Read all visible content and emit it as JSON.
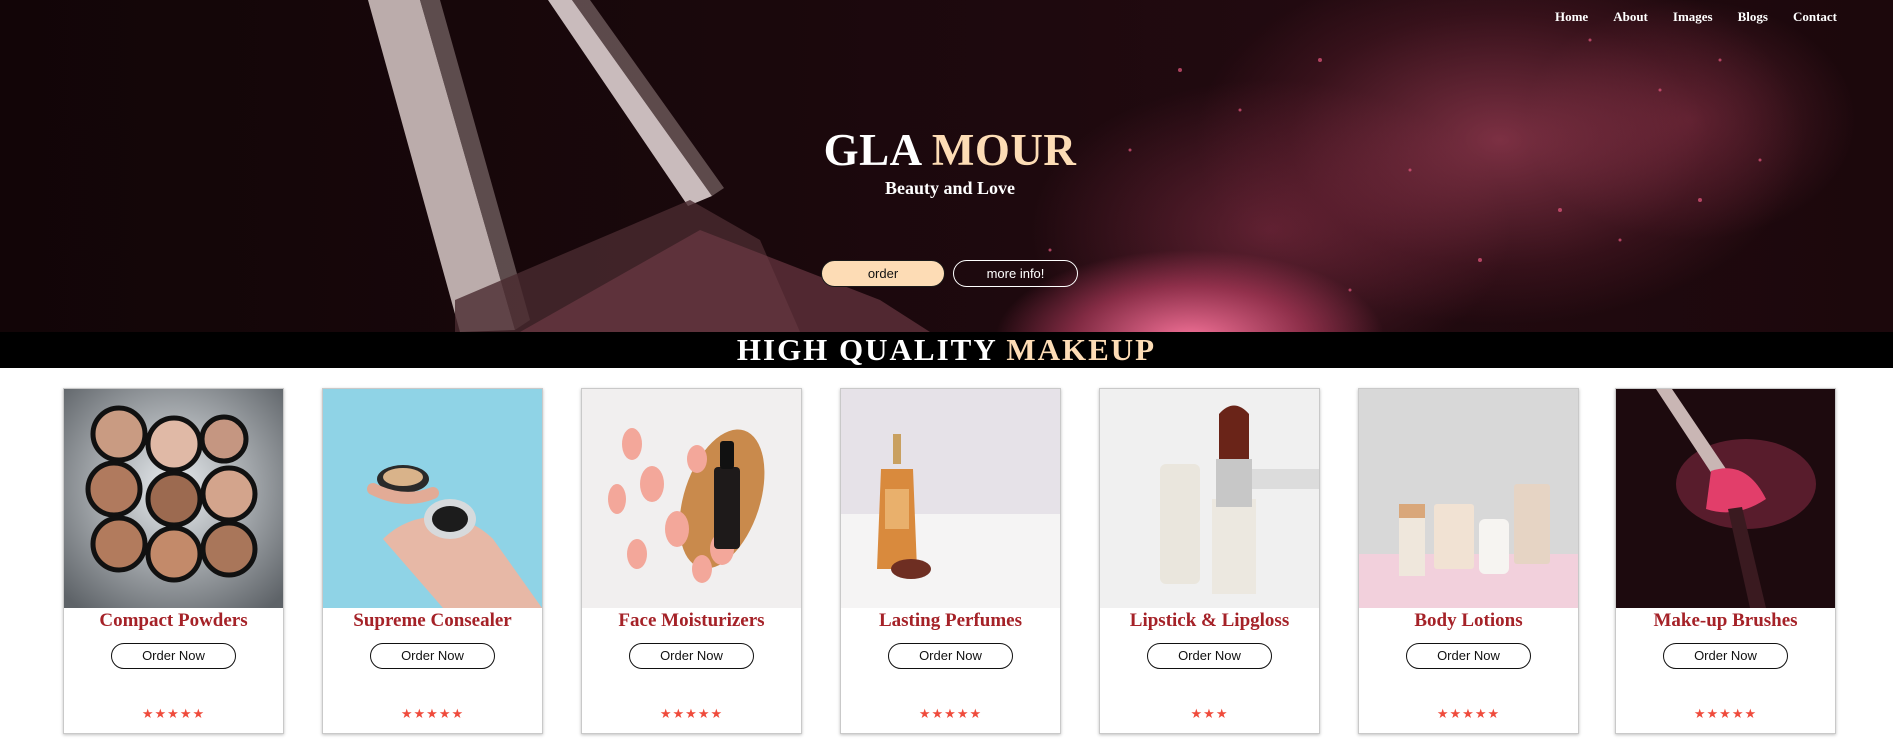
{
  "nav": {
    "items": [
      {
        "label": "Home"
      },
      {
        "label": "About"
      },
      {
        "label": "Images"
      },
      {
        "label": "Blogs"
      },
      {
        "label": "Contact"
      }
    ]
  },
  "hero": {
    "brand_part1": "GLA ",
    "brand_part2": "MOUR",
    "tagline": "Beauty and Love",
    "order_label": "order",
    "more_label": "more info!"
  },
  "banner": {
    "part1": "HIGH QUALITY ",
    "part2": "MAKEUP"
  },
  "products": [
    {
      "title": "Compact Powders",
      "button": "Order Now",
      "stars": "★★★★★",
      "rating": 5
    },
    {
      "title": "Supreme Consealer",
      "button": "Order Now",
      "stars": "★★★★★",
      "rating": 5
    },
    {
      "title": "Face Moisturizers",
      "button": "Order Now",
      "stars": "★★★★★",
      "rating": 5
    },
    {
      "title": "Lasting Perfumes",
      "button": "Order Now",
      "stars": "★★★★★",
      "rating": 5
    },
    {
      "title": "Lipstick & Lipgloss",
      "button": "Order Now",
      "stars": "★★★",
      "rating": 3
    },
    {
      "title": "Body Lotions",
      "button": "Order Now",
      "stars": "★★★★★",
      "rating": 5
    },
    {
      "title": "Make-up Brushes",
      "button": "Order Now",
      "stars": "★★★★★",
      "rating": 5
    }
  ],
  "colors": {
    "accent_peach": "#fddcb5",
    "product_title": "#a52228",
    "star": "#ef4b3c",
    "hero_dark": "#1a080c"
  }
}
